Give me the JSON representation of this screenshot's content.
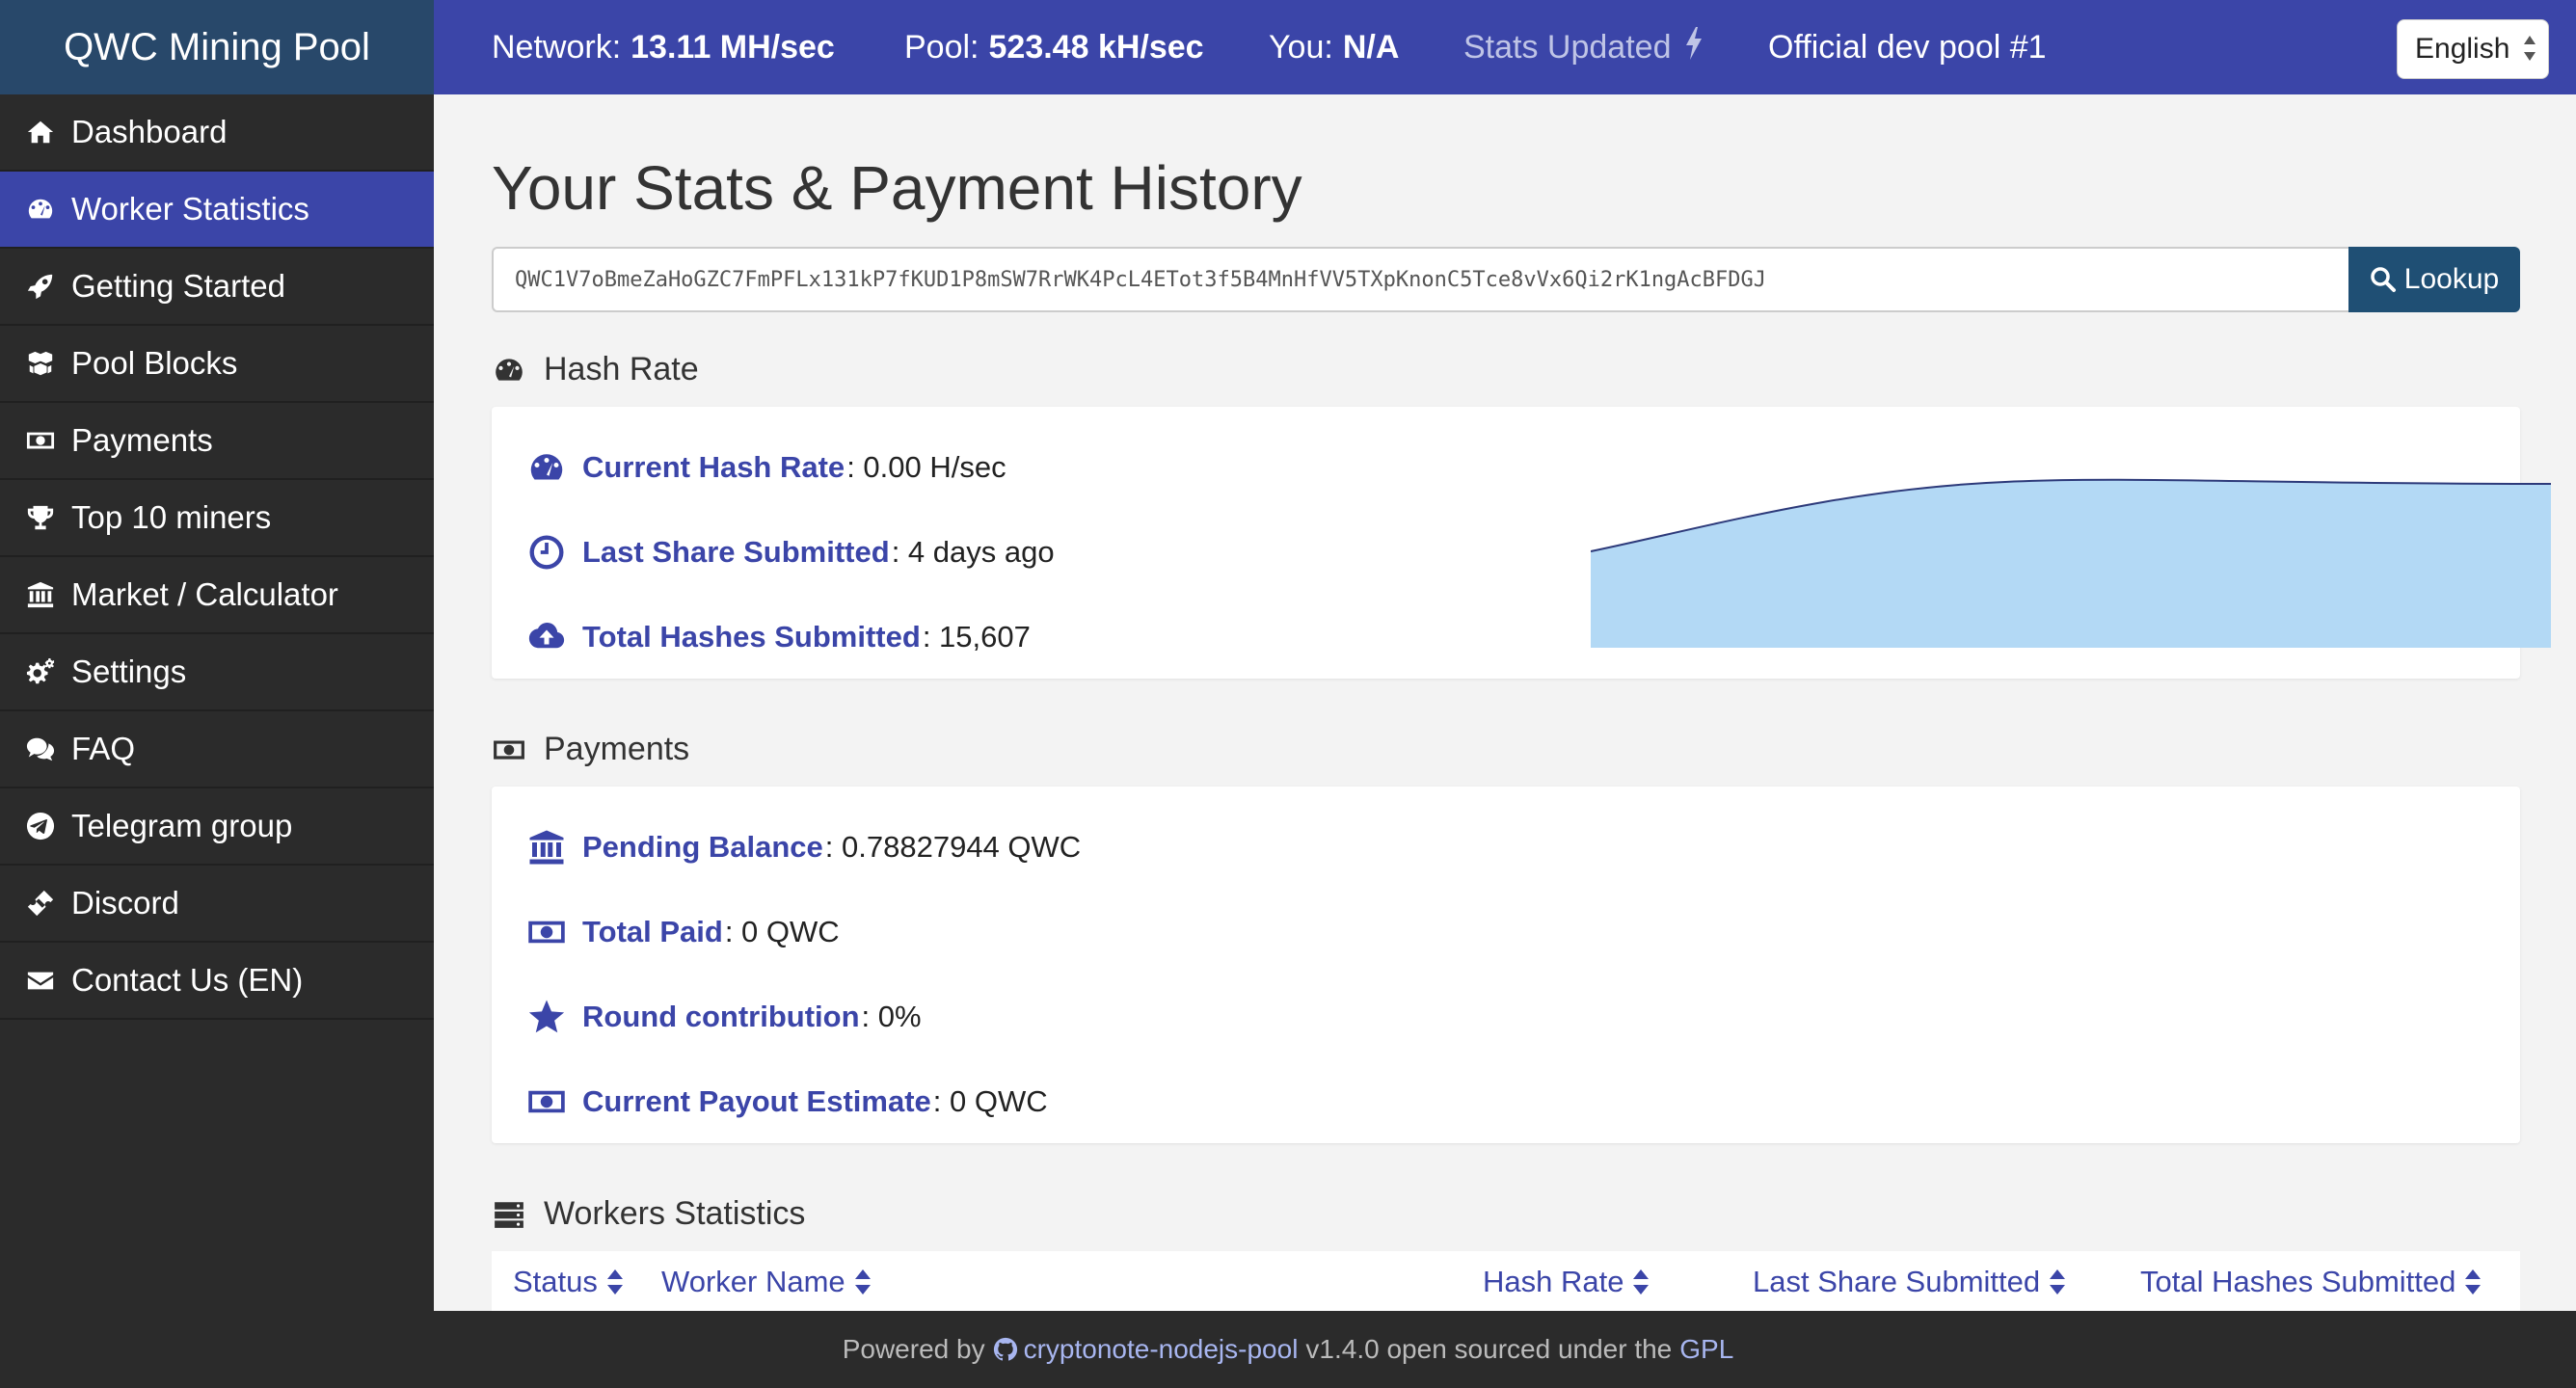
{
  "brand": "QWC Mining Pool",
  "topbar": {
    "network_label": "Network:",
    "network_value": "13.11 MH/sec",
    "pool_label": "Pool:",
    "pool_value": "523.48 kH/sec",
    "you_label": "You:",
    "you_value": "N/A",
    "stats_updated": "Stats Updated",
    "official": "Official dev pool #1",
    "language": "English"
  },
  "sidebar": {
    "items": [
      {
        "label": "Dashboard",
        "icon": "home-icon"
      },
      {
        "label": "Worker Statistics",
        "icon": "dashboard-icon",
        "active": true
      },
      {
        "label": "Getting Started",
        "icon": "rocket-icon"
      },
      {
        "label": "Pool Blocks",
        "icon": "cubes-icon"
      },
      {
        "label": "Payments",
        "icon": "money-icon"
      },
      {
        "label": "Top 10 miners",
        "icon": "trophy-icon"
      },
      {
        "label": "Market / Calculator",
        "icon": "bank-icon"
      },
      {
        "label": "Settings",
        "icon": "gears-icon"
      },
      {
        "label": "FAQ",
        "icon": "comments-icon"
      },
      {
        "label": "Telegram group",
        "icon": "telegram-icon"
      },
      {
        "label": "Discord",
        "icon": "ticket-icon"
      },
      {
        "label": "Contact Us (EN)",
        "icon": "envelope-icon"
      }
    ]
  },
  "main": {
    "title": "Your Stats & Payment History",
    "address": "QWC1V7oBmeZaHoGZC7FmPFLx131kP7fKUD1P8mSW7RrWK4PcL4ETot3f5B4MnHfVV5TXpKnonC5Tce8vVx6Qi2rK1ngAcBFDGJ",
    "lookup": "Lookup",
    "hashrate": {
      "heading": "Hash Rate",
      "rows": [
        {
          "label": "Current Hash Rate",
          "value": ": 0.00 H/sec"
        },
        {
          "label": "Last Share Submitted",
          "value": ": 4 days ago"
        },
        {
          "label": "Total Hashes Submitted",
          "value": ": 15,607"
        }
      ]
    },
    "payments": {
      "heading": "Payments",
      "rows": [
        {
          "label": "Pending Balance",
          "value": ": 0.78827944 QWC"
        },
        {
          "label": "Total Paid",
          "value": ": 0 QWC"
        },
        {
          "label": "Round contribution",
          "value": ": 0%"
        },
        {
          "label": "Current Payout Estimate",
          "value": ": 0 QWC"
        }
      ]
    },
    "workers": {
      "heading": "Workers Statistics",
      "columns": [
        "Status",
        "Worker Name",
        "Hash Rate",
        "Last Share Submitted",
        "Total Hashes Submitted"
      ]
    }
  },
  "footer": {
    "powered": "Powered by",
    "project": "cryptonote-nodejs-pool",
    "version_text": "v1.4.0 open sourced under the",
    "license": "GPL"
  },
  "colors": {
    "accent": "#3b45a8",
    "brand_bg": "#28486a",
    "sidebar_bg": "#2b2b2b",
    "chart_fill": "#b3d9f5",
    "chart_line": "#2d3a7a"
  }
}
